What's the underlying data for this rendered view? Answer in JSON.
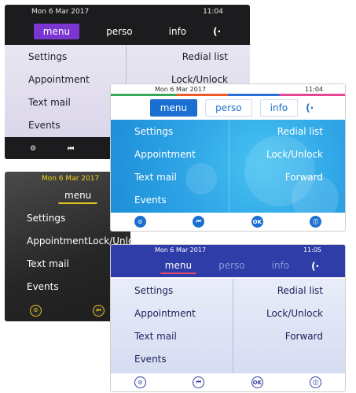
{
  "screens": {
    "violet": {
      "status": {
        "date": "Mon 6 Mar 2017",
        "time": "11:04"
      },
      "tabs": [
        "menu",
        "perso",
        "info"
      ],
      "exit_glyph": "(·",
      "rows": [
        {
          "left": "Settings",
          "right": "Redial list"
        },
        {
          "left": "Appointment",
          "right": "Lock/Unlock"
        },
        {
          "left": "Text mail",
          "right": ""
        },
        {
          "left": "Events",
          "right": ""
        }
      ],
      "softkeys": [
        "⚙",
        "⏮"
      ],
      "colors": {
        "accent": "#7b36d1",
        "bar": "#1c1c1f",
        "body": "#e3e0ee"
      }
    },
    "black": {
      "status": {
        "date": "Mon 6 Mar 2017"
      },
      "tabs": [
        "menu"
      ],
      "rows": [
        {
          "left": "Settings",
          "right": ""
        },
        {
          "left": "Appointment",
          "right": "Lock/Unlock"
        },
        {
          "left": "Text mail",
          "right": ""
        },
        {
          "left": "Events",
          "right": ""
        }
      ],
      "softkeys": [
        "⚙",
        "⏮"
      ],
      "colors": {
        "accent": "#e8c21a",
        "body": "#2a2a2a"
      }
    },
    "aqua": {
      "status": {
        "date": "Mon 6 Mar 2017",
        "time": "11:04"
      },
      "tabs": [
        "menu",
        "perso",
        "info"
      ],
      "exit_glyph": "(·",
      "rows": [
        {
          "left": "Settings",
          "right": "Redial list"
        },
        {
          "left": "Appointment",
          "right": "Lock/Unlock"
        },
        {
          "left": "Text mail",
          "right": "Forward"
        },
        {
          "left": "Events",
          "right": ""
        }
      ],
      "softkeys": [
        "⚙",
        "⏮",
        "OK",
        "ⓘ"
      ],
      "colors": {
        "accent": "#1a6fd0",
        "body": "#2ea4e6"
      }
    },
    "navy": {
      "status": {
        "date": "Mon 6 Mar 2017",
        "time": "11:05"
      },
      "tabs": [
        "menu",
        "perso",
        "info"
      ],
      "exit_glyph": "(·",
      "rows": [
        {
          "left": "Settings",
          "right": "Redial list"
        },
        {
          "left": "Appointment",
          "right": "Lock/Unlock"
        },
        {
          "left": "Text mail",
          "right": "Forward"
        },
        {
          "left": "Events",
          "right": ""
        }
      ],
      "softkeys": [
        "⚙",
        "⏮",
        "OK",
        "ⓘ"
      ],
      "colors": {
        "accent": "#2f3da8",
        "tab_underline": "#e24a6a",
        "body": "#dfe3f5"
      }
    }
  }
}
